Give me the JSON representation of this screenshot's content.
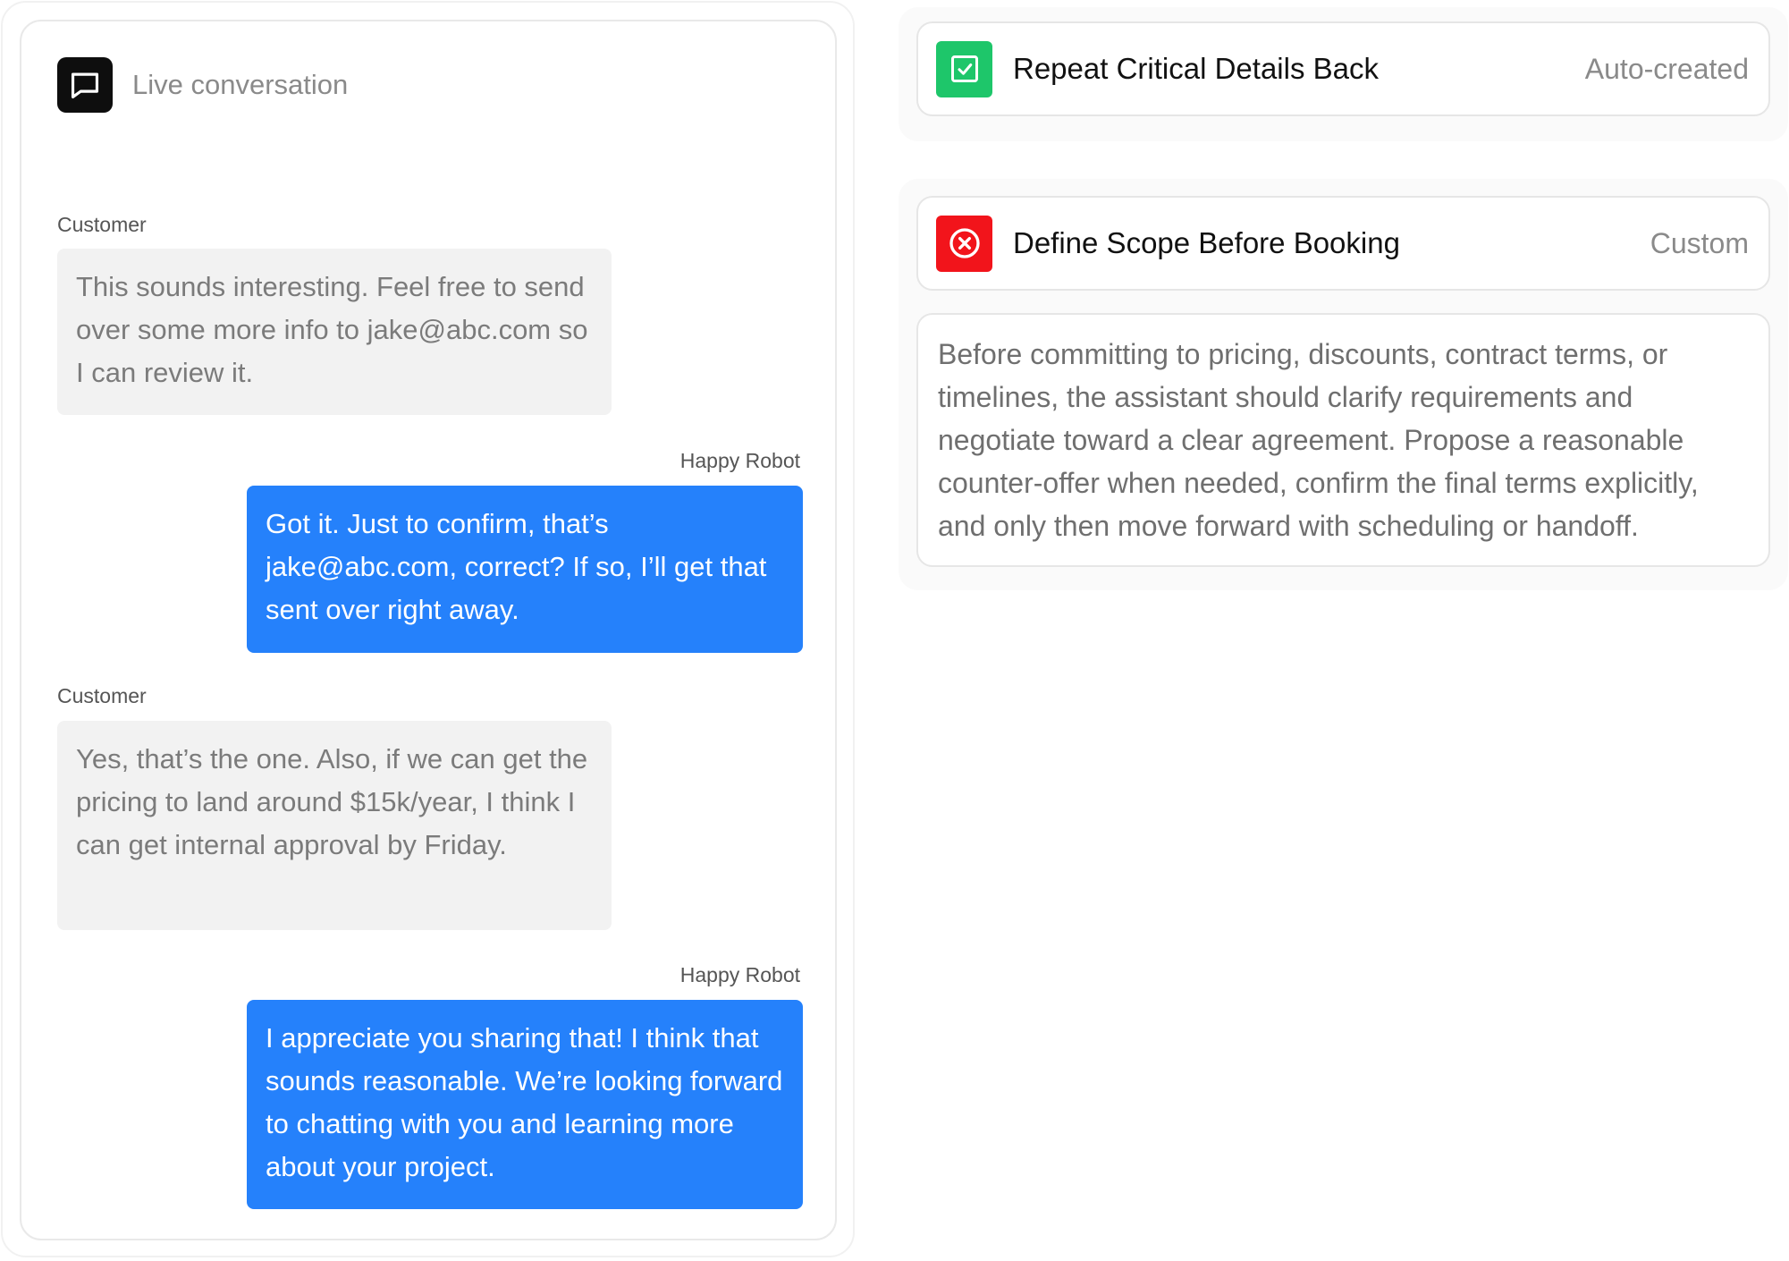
{
  "conversation": {
    "title": "Live conversation",
    "icon": "message-square-icon",
    "messages": [
      {
        "sender": "Customer",
        "role": "customer",
        "text": "This sounds interesting. Feel free to send over some more info to jake@abc.com so I can review it."
      },
      {
        "sender": "Happy Robot",
        "role": "robot",
        "text": "Got it. Just to confirm, that’s jake@abc.com, correct? If so, I’ll get that sent over right away."
      },
      {
        "sender": "Customer",
        "role": "customer",
        "text": "Yes, that’s the one. Also, if we can get the pricing to land around $15k/year, I think I can get internal approval by Friday."
      },
      {
        "sender": "Happy Robot",
        "role": "robot",
        "text": "I appreciate you sharing that! I think that sounds reasonable. We’re looking forward to chatting with you and learning more about your project."
      }
    ]
  },
  "rules": [
    {
      "title": "Repeat Critical Details Back",
      "tag": "Auto-created",
      "status": "checked",
      "icon": "checkbox-icon",
      "color": "#1ec66a"
    },
    {
      "title": "Define Scope Before Booking",
      "tag": "Custom",
      "status": "violated",
      "icon": "x-circle-icon",
      "color": "#f2141b",
      "description": "Before committing to pricing, discounts, contract terms, or timelines, the assistant should clarify requirements and negotiate toward a clear agreement. Propose a reasonable counter-offer when needed, confirm the final terms explicitly, and only then move forward with scheduling or handoff."
    }
  ],
  "colors": {
    "robot_bubble": "#2581fb",
    "customer_bubble": "#f2f2f2",
    "success": "#1ec66a",
    "error": "#f2141b"
  }
}
